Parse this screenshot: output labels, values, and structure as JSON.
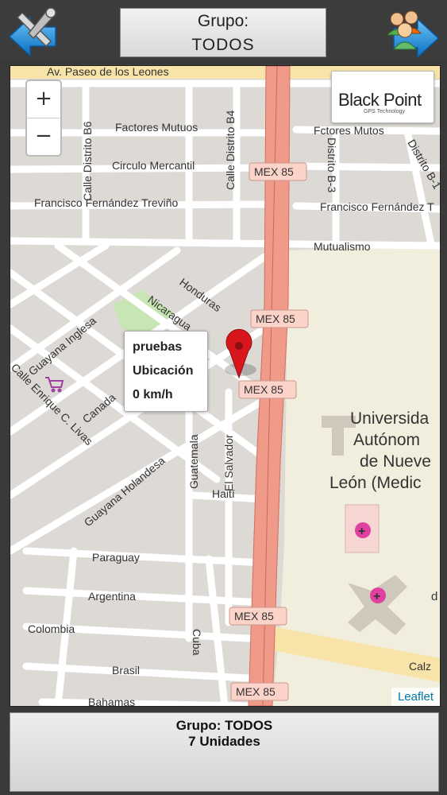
{
  "header": {
    "group_label": "Grupo:",
    "group_value": "TODOS",
    "back_icon": "tools-back-arrow-icon",
    "groups_icon": "users-forward-arrow-icon"
  },
  "map": {
    "zoom_in": "+",
    "zoom_out": "−",
    "brand": "Black Point",
    "brand_tagline": "GPS Technology",
    "attribution": "Leaflet",
    "streets": {
      "paseo": "Av. Paseo de los Leones",
      "factores": "Factores Mutuos",
      "fctores": "Fctores Mutos",
      "circulo": "Circulo Mercantil",
      "francisco": "Francisco Fernández Treviño",
      "francisco2": "Francisco Fernández T",
      "mutualismo": "Mutualismo",
      "calle_b6": "Calle Distrito B6",
      "calle_b4": "Calle Distrito B4",
      "distrito_b3": "Distrito B-3",
      "distrito_b1": "Distrito B-1",
      "honduras": "Honduras",
      "nicaragua": "Nicaragua",
      "guayana_inglesa": "Guayana Inglesa",
      "enrique": "Calle Enrique C. Livas",
      "canada": "Canada",
      "guayana_holandesa": "Guayana Holandesa",
      "guatemala": "Guatemala",
      "el_salvador": "El Salvador",
      "haiti": "Haití",
      "paraguay": "Paraguay",
      "argentina": "Argentina",
      "colombia": "Colombia",
      "cuba": "Cuba",
      "brasil": "Brasil",
      "bahamas": "Bahamas",
      "calz": "Calz",
      "uni1": "Universida",
      "uni2": "Autónom",
      "uni3": "de Nueve",
      "uni4": "León (Medic",
      "uni5": "d"
    },
    "highway": "MEX 85",
    "marker_icon": "map-pin-icon",
    "popup": {
      "name": "pruebas",
      "location": "Ubicación",
      "speed": "0 km/h"
    },
    "colors": {
      "highway": "#f09a8a",
      "park": "#c8e6b4",
      "campus": "#f1eedd",
      "marker": "#d8161c"
    }
  },
  "footer": {
    "group": "Grupo: TODOS",
    "units": "7 Unidades"
  }
}
